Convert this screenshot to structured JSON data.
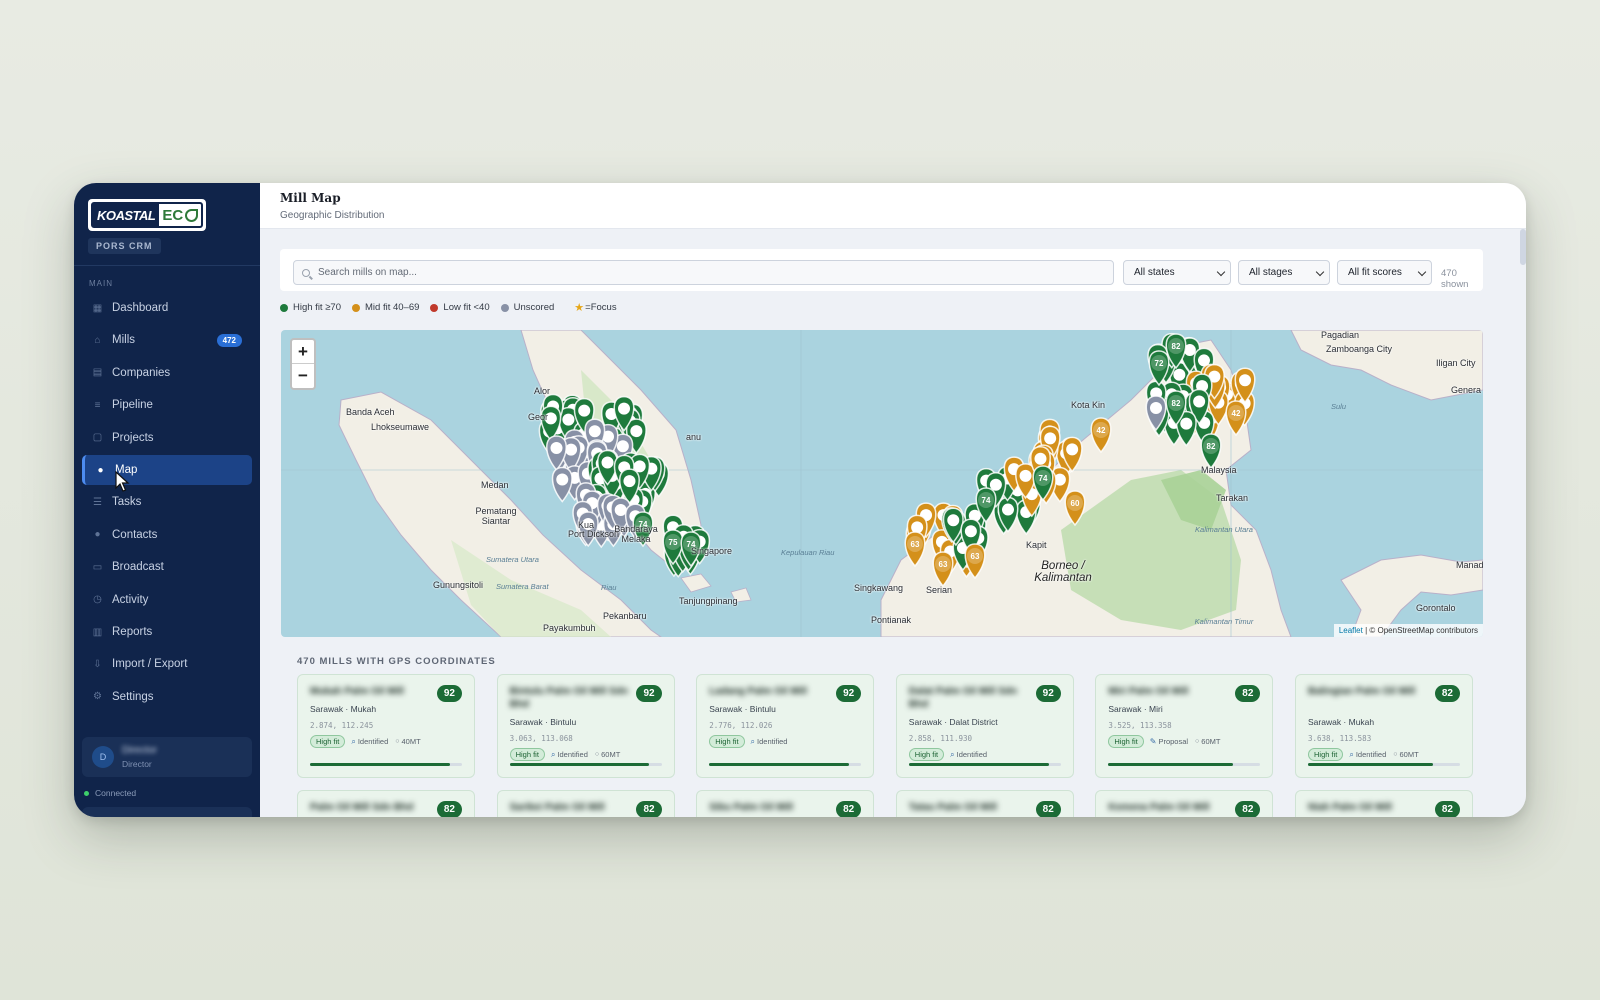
{
  "sidebar": {
    "brand_left": "KOASTAL",
    "brand_right": "EC",
    "crm_badge": "PORS CRM",
    "section_label": "MAIN",
    "items": [
      {
        "label": "Dashboard",
        "icon": "grid-icon"
      },
      {
        "label": "Mills",
        "icon": "factory-icon",
        "badge": "472"
      },
      {
        "label": "Companies",
        "icon": "building-icon"
      },
      {
        "label": "Pipeline",
        "icon": "filter-icon"
      },
      {
        "label": "Projects",
        "icon": "folder-icon"
      },
      {
        "label": "Map",
        "icon": "map-pin-icon",
        "active": true
      },
      {
        "label": "Tasks",
        "icon": "checklist-icon"
      },
      {
        "label": "Contacts",
        "icon": "person-icon"
      },
      {
        "label": "Broadcast",
        "icon": "message-icon"
      },
      {
        "label": "Activity",
        "icon": "clock-icon"
      },
      {
        "label": "Reports",
        "icon": "chart-icon"
      },
      {
        "label": "Import / Export",
        "icon": "download-icon"
      },
      {
        "label": "Settings",
        "icon": "gear-icon"
      }
    ],
    "user": {
      "initial": "D",
      "name": "Director",
      "role": "Director"
    },
    "status": "Connected"
  },
  "header": {
    "title": "Mill Map",
    "subtitle": "Geographic Distribution"
  },
  "toolbar": {
    "search_placeholder": "Search mills on map...",
    "state_filter": "All states",
    "stage_filter": "All stages",
    "fit_filter": "All fit scores",
    "shown_count": "470 shown"
  },
  "legend": {
    "high": "High fit ≥70",
    "mid": "Mid fit 40–69",
    "low": "Low fit <40",
    "unscored": "Unscored",
    "focus": "=Focus"
  },
  "colors": {
    "high": "#1e7a3c",
    "mid": "#d4901a",
    "low": "#c0392b",
    "unscored": "#8891a6",
    "accent": "#2a6fd6",
    "sidebar": "#10244a"
  },
  "map": {
    "zoom_in": "+",
    "zoom_out": "−",
    "attribution_link": "Leaflet",
    "attribution_rest": " | © OpenStreetMap contributors",
    "labels": [
      {
        "text": "Pagadian",
        "cls": ""
      },
      {
        "text": "Zamboanga City",
        "cls": ""
      },
      {
        "text": "Iligan City",
        "cls": ""
      },
      {
        "text": "Genera",
        "cls": ""
      },
      {
        "text": "Banda Aceh",
        "cls": ""
      },
      {
        "text": "Lhokseumawe",
        "cls": ""
      },
      {
        "text": "Alor",
        "cls": ""
      },
      {
        "text": "Geor",
        "cls": ""
      },
      {
        "text": "anu",
        "cls": ""
      },
      {
        "text": "Kota Kin",
        "cls": ""
      },
      {
        "text": "Medan",
        "cls": ""
      },
      {
        "text": "Pematang Siantar",
        "cls": ""
      },
      {
        "text": "Kua",
        "cls": ""
      },
      {
        "text": "Port Dickson",
        "cls": ""
      },
      {
        "text": "Bandaraya Melaka",
        "cls": ""
      },
      {
        "text": "Singapore",
        "cls": ""
      },
      {
        "text": "Tanjungpinang",
        "cls": ""
      },
      {
        "text": "Gunungsitoli",
        "cls": ""
      },
      {
        "text": "Pekanbaru",
        "cls": ""
      },
      {
        "text": "Payakumbuh",
        "cls": ""
      },
      {
        "text": "Kepulauan Riau",
        "cls": "sea"
      },
      {
        "text": "Kapit",
        "cls": ""
      },
      {
        "text": "Borneo / Kalimantan",
        "cls": "big"
      },
      {
        "text": "Singkawang",
        "cls": ""
      },
      {
        "text": "Pontianak",
        "cls": ""
      },
      {
        "text": "Serian",
        "cls": ""
      },
      {
        "text": "Tarakan",
        "cls": ""
      },
      {
        "text": "Kalimantan Utara",
        "cls": "sea"
      },
      {
        "text": "Kalimantan Timur",
        "cls": "sea"
      },
      {
        "text": "Sulu",
        "cls": "sea"
      },
      {
        "text": "Manad",
        "cls": ""
      },
      {
        "text": "Gorontalo",
        "cls": ""
      },
      {
        "text": "Malaysia",
        "cls": ""
      },
      {
        "text": "Sumatera Utara",
        "cls": "sea"
      },
      {
        "text": "Sumatera Barat",
        "cls": "sea"
      },
      {
        "text": "Riau",
        "cls": "sea"
      }
    ],
    "pin_labels": [
      {
        "value": "72",
        "fit": "high"
      },
      {
        "value": "82",
        "fit": "high"
      },
      {
        "value": "82",
        "fit": "high"
      },
      {
        "value": "82",
        "fit": "high"
      },
      {
        "value": "42",
        "fit": "mid"
      },
      {
        "value": "42",
        "fit": "mid"
      },
      {
        "value": "74",
        "fit": "high"
      },
      {
        "value": "75",
        "fit": "high"
      },
      {
        "value": "74",
        "fit": "high"
      },
      {
        "value": "63",
        "fit": "mid"
      },
      {
        "value": "60",
        "fit": "mid"
      },
      {
        "value": "74",
        "fit": "high"
      },
      {
        "value": "74",
        "fit": "high"
      },
      {
        "value": "63",
        "fit": "mid"
      },
      {
        "value": "63",
        "fit": "mid"
      }
    ]
  },
  "list": {
    "title": "470 MILLS WITH GPS COORDINATES",
    "cards": [
      {
        "name": "Mukah Palm Oil Mill",
        "score": "92",
        "location": "Sarawak · Mukah",
        "coords": "2.874, 112.245",
        "fit": "High fit",
        "stage": "Identified",
        "capacity": "40MT",
        "progress": 0.92
      },
      {
        "name": "Bintulu Palm Oil Mill Sdn Bhd",
        "score": "92",
        "location": "Sarawak · Bintulu",
        "coords": "3.063, 113.068",
        "fit": "High fit",
        "stage": "Identified",
        "capacity": "60MT",
        "progress": 0.92
      },
      {
        "name": "Ladang Palm Oil Mill",
        "score": "92",
        "location": "Sarawak · Bintulu",
        "coords": "2.776, 112.026",
        "fit": "High fit",
        "stage": "Identified",
        "capacity": "",
        "progress": 0.92
      },
      {
        "name": "Dalat Palm Oil Mill Sdn Bhd",
        "score": "92",
        "location": "Sarawak · Dalat District",
        "coords": "2.858, 111.930",
        "fit": "High fit",
        "stage": "Identified",
        "capacity": "",
        "progress": 0.92
      },
      {
        "name": "Miri Palm Oil Mill",
        "score": "82",
        "location": "Sarawak · Miri",
        "coords": "3.525, 113.358",
        "fit": "High fit",
        "stage": "Proposal",
        "capacity": "60MT",
        "progress": 0.82
      },
      {
        "name": "Balingian Palm Oil Mill",
        "score": "82",
        "location": "Sarawak · Mukah",
        "coords": "3.638, 113.583",
        "fit": "High fit",
        "stage": "Identified",
        "capacity": "60MT",
        "progress": 0.82
      },
      {
        "name": "Palm Oil Mill Sdn Bhd",
        "score": "82",
        "location": "",
        "coords": "",
        "fit": "",
        "stage": "",
        "capacity": "",
        "progress": 0
      },
      {
        "name": "Sarikei Palm Oil Mill",
        "score": "82",
        "location": "",
        "coords": "",
        "fit": "",
        "stage": "",
        "capacity": "",
        "progress": 0
      },
      {
        "name": "Sibu Palm Oil Mill",
        "score": "82",
        "location": "",
        "coords": "",
        "fit": "",
        "stage": "",
        "capacity": "",
        "progress": 0
      },
      {
        "name": "Tatau Palm Oil Mill",
        "score": "82",
        "location": "",
        "coords": "",
        "fit": "",
        "stage": "",
        "capacity": "",
        "progress": 0
      },
      {
        "name": "Kemena Palm Oil Mill",
        "score": "82",
        "location": "",
        "coords": "",
        "fit": "",
        "stage": "",
        "capacity": "",
        "progress": 0
      },
      {
        "name": "Niah Palm Oil Mill",
        "score": "82",
        "location": "",
        "coords": "",
        "fit": "",
        "stage": "",
        "capacity": "",
        "progress": 0
      }
    ]
  }
}
